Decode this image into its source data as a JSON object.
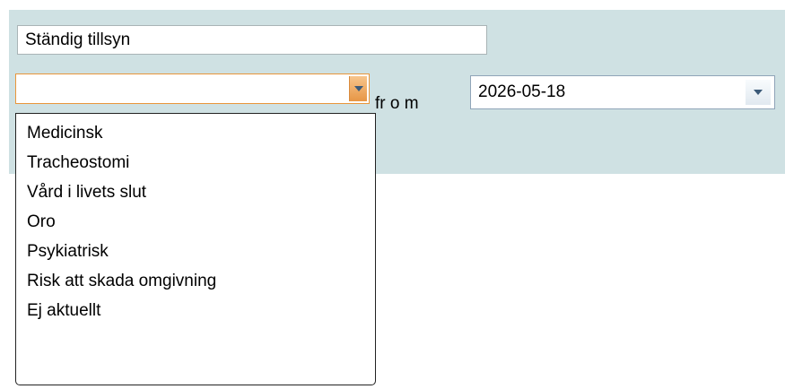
{
  "form": {
    "supervision_value": "Ständig tillsyn",
    "type_value": "",
    "from_label": "fr o m",
    "date_value": "2026-05-18"
  },
  "dropdown": {
    "options": [
      "Medicinsk",
      "Tracheostomi",
      "Vård i livets slut",
      "Oro",
      "Psykiatrisk",
      "Risk att skada omgivning",
      "Ej aktuellt"
    ]
  },
  "colors": {
    "panel_background": "#cfe1e3",
    "combo_focus_border": "#e8963a",
    "dropdown_border": "#222222"
  },
  "icons": {
    "combo_arrow": "chevron-down-icon",
    "date_arrow": "chevron-down-icon"
  }
}
